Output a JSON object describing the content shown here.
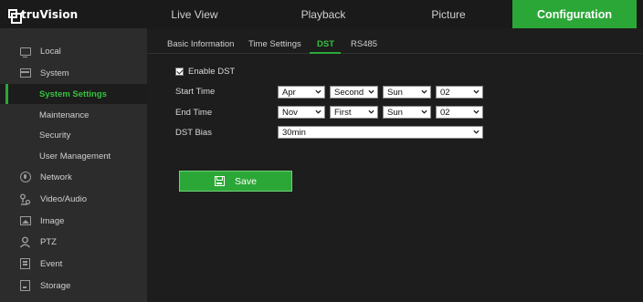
{
  "brand": {
    "name": "truVision"
  },
  "nav": {
    "tabs": [
      {
        "label": "Live View"
      },
      {
        "label": "Playback"
      },
      {
        "label": "Picture"
      },
      {
        "label": "Configuration"
      }
    ],
    "active": "Configuration",
    "accent_color": "#2ba737"
  },
  "sidebar": {
    "items": [
      {
        "label": "Local",
        "icon": "monitor-icon"
      },
      {
        "label": "System",
        "icon": "window-icon"
      },
      {
        "label": "System Settings",
        "selected": true
      },
      {
        "label": "Maintenance"
      },
      {
        "label": "Security"
      },
      {
        "label": "User Management"
      },
      {
        "label": "Network",
        "icon": "globe-icon"
      },
      {
        "label": "Video/Audio",
        "icon": "video-audio-icon"
      },
      {
        "label": "Image",
        "icon": "image-icon"
      },
      {
        "label": "PTZ",
        "icon": "ptz-icon"
      },
      {
        "label": "Event",
        "icon": "calendar-icon"
      },
      {
        "label": "Storage",
        "icon": "storage-icon"
      }
    ]
  },
  "subtabs": {
    "items": [
      {
        "label": "Basic Information"
      },
      {
        "label": "Time Settings"
      },
      {
        "label": "DST"
      },
      {
        "label": "RS485"
      }
    ],
    "active": "DST"
  },
  "form": {
    "enable_dst": {
      "label": "Enable DST",
      "checked": true
    },
    "start_time": {
      "label": "Start Time",
      "month": "Apr",
      "week": "Second",
      "day": "Sun",
      "hour": "02"
    },
    "end_time": {
      "label": "End Time",
      "month": "Nov",
      "week": "First",
      "day": "Sun",
      "hour": "02"
    },
    "dst_bias": {
      "label": "DST Bias",
      "value": "30min"
    },
    "save_label": "Save"
  }
}
